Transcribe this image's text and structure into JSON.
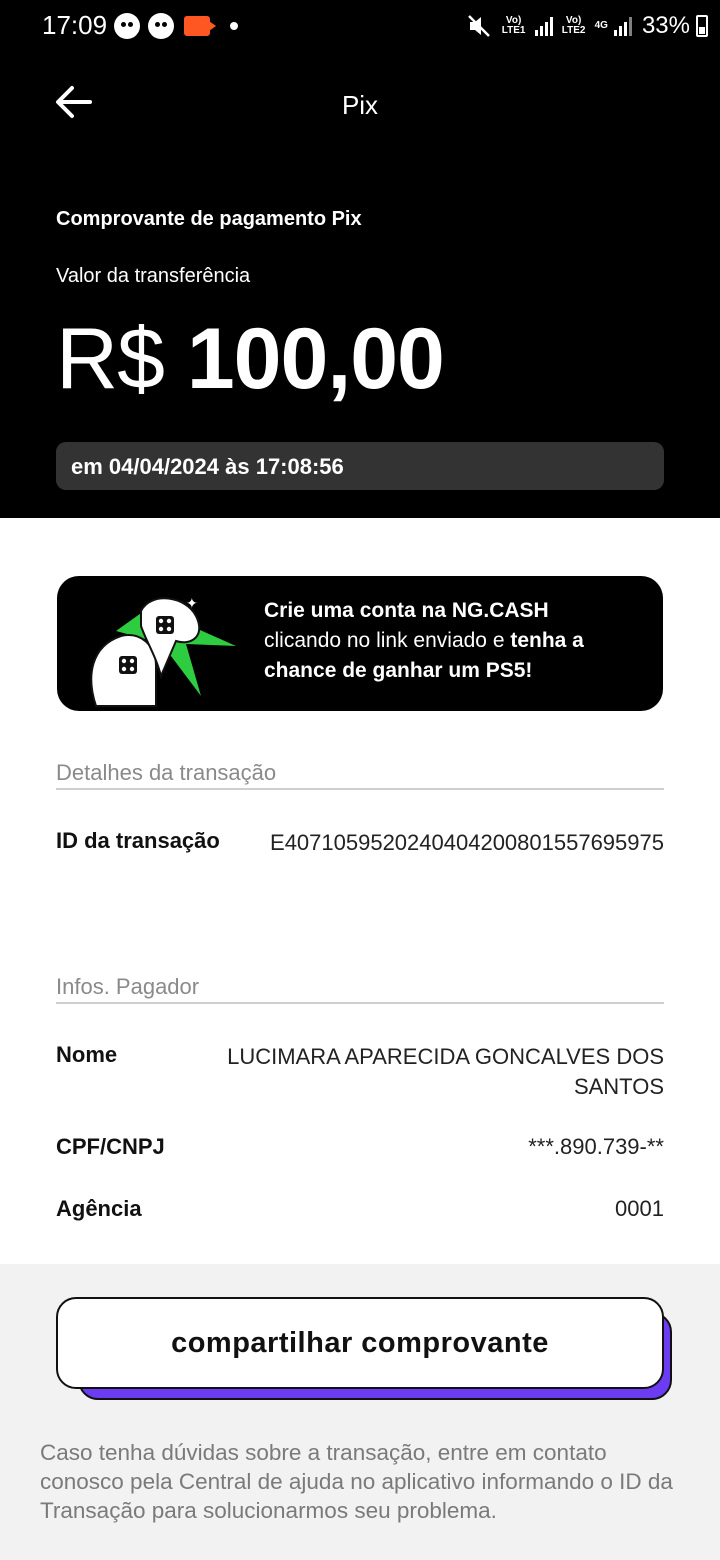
{
  "status_bar": {
    "time": "17:09",
    "signal1": "Vo) LTE1",
    "signal2": "Vo) LTE2",
    "network": "4G",
    "battery": "33%"
  },
  "header": {
    "title": "Pix",
    "back_icon": "arrow-left-icon"
  },
  "receipt": {
    "title": "Comprovante de pagamento Pix",
    "amount_label": "Valor da transferência",
    "currency": "R$",
    "amount": "100,00",
    "date": "em 04/04/2024 às 17:08:56"
  },
  "banner": {
    "line1_bold": "Crie uma conta na NG.CASH",
    "line2": "clicando no link enviado e ",
    "line2_bold": "tenha a",
    "line3_bold": "chance de ganhar um PS5!"
  },
  "transaction": {
    "section_title": "Detalhes da transação",
    "id_label": "ID da transação",
    "id_value": "E4071059520240404200801557695975"
  },
  "payer": {
    "section_title": "Infos. Pagador",
    "rows": [
      {
        "label": "Nome",
        "value": "LUCIMARA APARECIDA GONCALVES DOS SANTOS"
      },
      {
        "label": "CPF/CNPJ",
        "value": "***.890.739-**"
      },
      {
        "label": "Agência",
        "value": "0001"
      }
    ]
  },
  "share_button": {
    "label": "compartilhar comprovante"
  },
  "help_text": "Caso tenha dúvidas sobre a transação, entre em contato conosco pela Central de ajuda no aplicativo informando o ID da Transação para solucionarmos seu problema.",
  "colors": {
    "header_bg": "#000000",
    "accent": "#6b3cf1",
    "banner_green": "#2ecc40"
  }
}
